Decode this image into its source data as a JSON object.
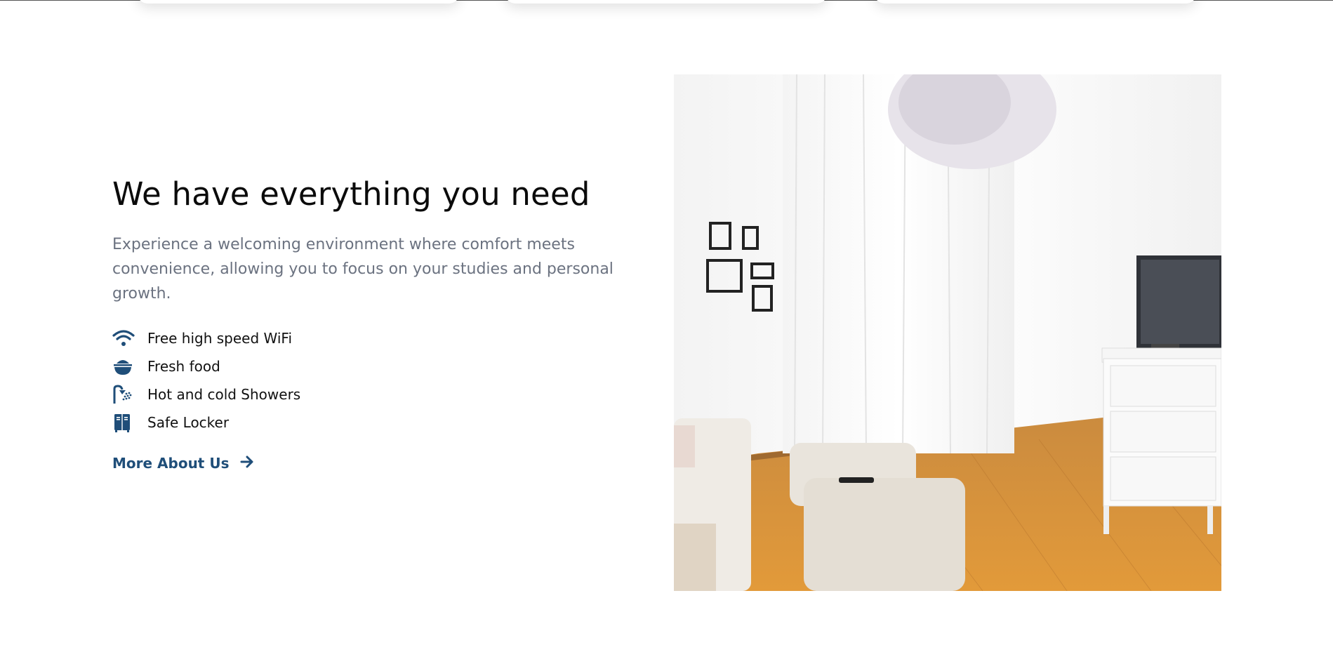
{
  "section": {
    "title": "We have everything you need",
    "description": "Experience a welcoming environment where comfort meets convenience, allowing you to focus on your studies and personal growth.",
    "features": [
      {
        "icon": "wifi-icon",
        "label": "Free high speed WiFi"
      },
      {
        "icon": "food-bowl-icon",
        "label": "Fresh food"
      },
      {
        "icon": "shower-icon",
        "label": "Hot and cold Showers"
      },
      {
        "icon": "locker-icon",
        "label": "Safe Locker"
      }
    ],
    "cta": {
      "label": "More About Us",
      "icon": "arrow-right-icon"
    }
  },
  "colors": {
    "accent": "#1f4e79",
    "muted_text": "#6b7280",
    "heading": "#0b0b0b"
  }
}
